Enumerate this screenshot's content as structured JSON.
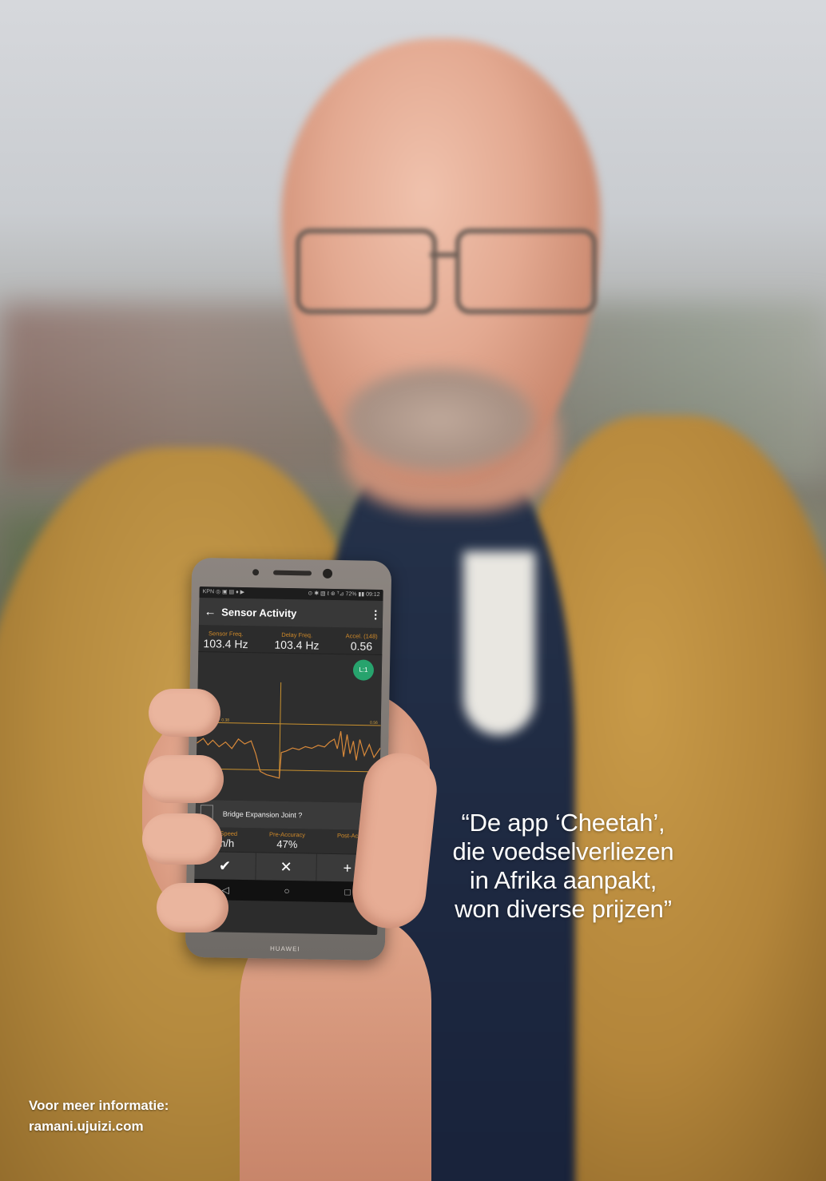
{
  "caption": {
    "quote_lines": [
      "“De app ‘Cheetah’,",
      "die voedselverliezen",
      "in Afrika aanpakt,",
      "won diverse prijzen”"
    ]
  },
  "footer": {
    "info_label": "Voor meer informatie:",
    "url": "ramani.ujuizi.com"
  },
  "phone": {
    "brand": "HUAWEI",
    "status_left": "KPN ◎ ▣ ▤ ♦ ▶",
    "status_right": "⊙ ✱ ▧ ℓ ⊛ ᵀ⊿ 72% ▮▮ 09:12",
    "app": {
      "title": "Sensor Activity",
      "back_icon": "←",
      "menu_icon": "⋮",
      "stats": [
        {
          "label": "Sensor Freq.",
          "value": "103.4 Hz"
        },
        {
          "label": "Delay Freq.",
          "value": "103.4 Hz"
        },
        {
          "label": "Accel. (148)",
          "value": "0.56"
        }
      ],
      "badge": "L:1",
      "threshold_label": "Threshold : 0.38",
      "threshold_value": "0.56",
      "question": "Bridge Expansion Joint ?",
      "metrics": [
        {
          "label": "Current Speed",
          "value": "1 Km/h"
        },
        {
          "label": "Pre-Accuracy",
          "value": "47%"
        },
        {
          "label": "Post-Accuracy",
          "value": ""
        }
      ],
      "actions": [
        "✔",
        "✕",
        "+"
      ],
      "nav": [
        "◁",
        "○",
        "□"
      ]
    }
  }
}
